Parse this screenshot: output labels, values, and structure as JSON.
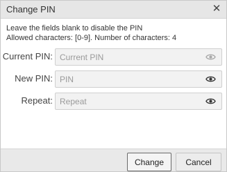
{
  "dialog": {
    "title": "Change PIN",
    "close_icon": "close-icon"
  },
  "info": {
    "line1": "Leave the fields blank to disable the PIN",
    "line2": "Allowed characters: [0-9]. Number of characters: 4"
  },
  "fields": {
    "current": {
      "label": "Current PIN:",
      "placeholder": "Current PIN",
      "value": "",
      "icon": "eye-icon"
    },
    "new": {
      "label": "New PIN:",
      "placeholder": "PIN",
      "value": "",
      "icon": "eye-icon"
    },
    "repeat": {
      "label": "Repeat:",
      "placeholder": "Repeat",
      "value": "",
      "icon": "eye-icon"
    }
  },
  "buttons": {
    "change": "Change",
    "cancel": "Cancel"
  }
}
